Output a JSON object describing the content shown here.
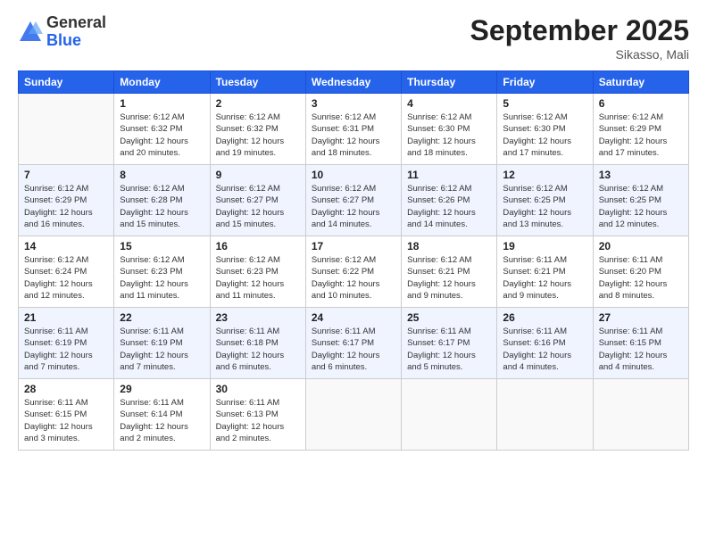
{
  "header": {
    "logo_general": "General",
    "logo_blue": "Blue",
    "month_title": "September 2025",
    "location": "Sikasso, Mali"
  },
  "weekdays": [
    "Sunday",
    "Monday",
    "Tuesday",
    "Wednesday",
    "Thursday",
    "Friday",
    "Saturday"
  ],
  "weeks": [
    [
      {
        "day": "",
        "info": ""
      },
      {
        "day": "1",
        "info": "Sunrise: 6:12 AM\nSunset: 6:32 PM\nDaylight: 12 hours\nand 20 minutes."
      },
      {
        "day": "2",
        "info": "Sunrise: 6:12 AM\nSunset: 6:32 PM\nDaylight: 12 hours\nand 19 minutes."
      },
      {
        "day": "3",
        "info": "Sunrise: 6:12 AM\nSunset: 6:31 PM\nDaylight: 12 hours\nand 18 minutes."
      },
      {
        "day": "4",
        "info": "Sunrise: 6:12 AM\nSunset: 6:30 PM\nDaylight: 12 hours\nand 18 minutes."
      },
      {
        "day": "5",
        "info": "Sunrise: 6:12 AM\nSunset: 6:30 PM\nDaylight: 12 hours\nand 17 minutes."
      },
      {
        "day": "6",
        "info": "Sunrise: 6:12 AM\nSunset: 6:29 PM\nDaylight: 12 hours\nand 17 minutes."
      }
    ],
    [
      {
        "day": "7",
        "info": "Sunrise: 6:12 AM\nSunset: 6:29 PM\nDaylight: 12 hours\nand 16 minutes."
      },
      {
        "day": "8",
        "info": "Sunrise: 6:12 AM\nSunset: 6:28 PM\nDaylight: 12 hours\nand 15 minutes."
      },
      {
        "day": "9",
        "info": "Sunrise: 6:12 AM\nSunset: 6:27 PM\nDaylight: 12 hours\nand 15 minutes."
      },
      {
        "day": "10",
        "info": "Sunrise: 6:12 AM\nSunset: 6:27 PM\nDaylight: 12 hours\nand 14 minutes."
      },
      {
        "day": "11",
        "info": "Sunrise: 6:12 AM\nSunset: 6:26 PM\nDaylight: 12 hours\nand 14 minutes."
      },
      {
        "day": "12",
        "info": "Sunrise: 6:12 AM\nSunset: 6:25 PM\nDaylight: 12 hours\nand 13 minutes."
      },
      {
        "day": "13",
        "info": "Sunrise: 6:12 AM\nSunset: 6:25 PM\nDaylight: 12 hours\nand 12 minutes."
      }
    ],
    [
      {
        "day": "14",
        "info": "Sunrise: 6:12 AM\nSunset: 6:24 PM\nDaylight: 12 hours\nand 12 minutes."
      },
      {
        "day": "15",
        "info": "Sunrise: 6:12 AM\nSunset: 6:23 PM\nDaylight: 12 hours\nand 11 minutes."
      },
      {
        "day": "16",
        "info": "Sunrise: 6:12 AM\nSunset: 6:23 PM\nDaylight: 12 hours\nand 11 minutes."
      },
      {
        "day": "17",
        "info": "Sunrise: 6:12 AM\nSunset: 6:22 PM\nDaylight: 12 hours\nand 10 minutes."
      },
      {
        "day": "18",
        "info": "Sunrise: 6:12 AM\nSunset: 6:21 PM\nDaylight: 12 hours\nand 9 minutes."
      },
      {
        "day": "19",
        "info": "Sunrise: 6:11 AM\nSunset: 6:21 PM\nDaylight: 12 hours\nand 9 minutes."
      },
      {
        "day": "20",
        "info": "Sunrise: 6:11 AM\nSunset: 6:20 PM\nDaylight: 12 hours\nand 8 minutes."
      }
    ],
    [
      {
        "day": "21",
        "info": "Sunrise: 6:11 AM\nSunset: 6:19 PM\nDaylight: 12 hours\nand 7 minutes."
      },
      {
        "day": "22",
        "info": "Sunrise: 6:11 AM\nSunset: 6:19 PM\nDaylight: 12 hours\nand 7 minutes."
      },
      {
        "day": "23",
        "info": "Sunrise: 6:11 AM\nSunset: 6:18 PM\nDaylight: 12 hours\nand 6 minutes."
      },
      {
        "day": "24",
        "info": "Sunrise: 6:11 AM\nSunset: 6:17 PM\nDaylight: 12 hours\nand 6 minutes."
      },
      {
        "day": "25",
        "info": "Sunrise: 6:11 AM\nSunset: 6:17 PM\nDaylight: 12 hours\nand 5 minutes."
      },
      {
        "day": "26",
        "info": "Sunrise: 6:11 AM\nSunset: 6:16 PM\nDaylight: 12 hours\nand 4 minutes."
      },
      {
        "day": "27",
        "info": "Sunrise: 6:11 AM\nSunset: 6:15 PM\nDaylight: 12 hours\nand 4 minutes."
      }
    ],
    [
      {
        "day": "28",
        "info": "Sunrise: 6:11 AM\nSunset: 6:15 PM\nDaylight: 12 hours\nand 3 minutes."
      },
      {
        "day": "29",
        "info": "Sunrise: 6:11 AM\nSunset: 6:14 PM\nDaylight: 12 hours\nand 2 minutes."
      },
      {
        "day": "30",
        "info": "Sunrise: 6:11 AM\nSunset: 6:13 PM\nDaylight: 12 hours\nand 2 minutes."
      },
      {
        "day": "",
        "info": ""
      },
      {
        "day": "",
        "info": ""
      },
      {
        "day": "",
        "info": ""
      },
      {
        "day": "",
        "info": ""
      }
    ]
  ]
}
